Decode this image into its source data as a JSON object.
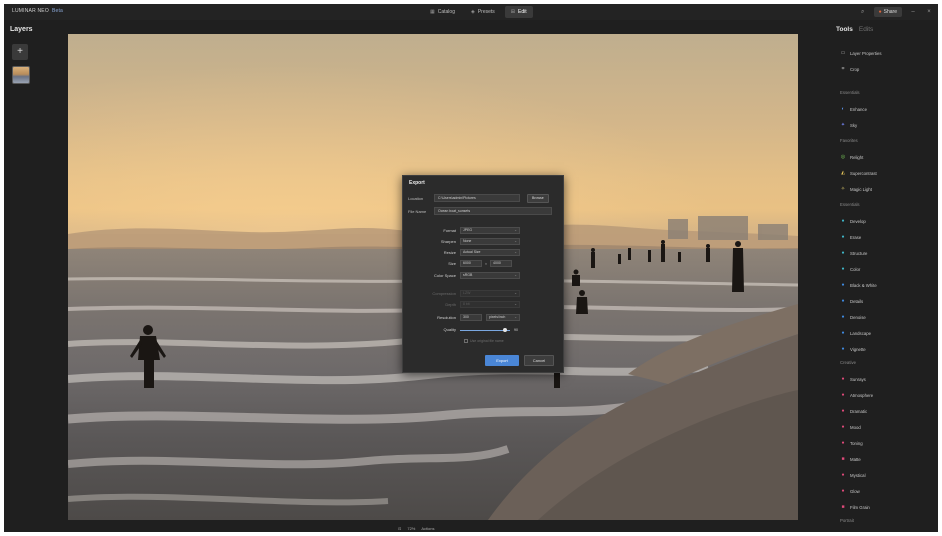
{
  "topbar": {
    "brand": "LUMINAR NEO",
    "edition": "Beta",
    "modes": [
      {
        "icon": "catalog-icon",
        "glyph": "▦",
        "label": "Catalog",
        "active": false
      },
      {
        "icon": "presets-icon",
        "glyph": "◈",
        "label": "Presets",
        "active": false
      },
      {
        "icon": "edit-icon",
        "glyph": "⊞",
        "label": "Edit",
        "active": true
      }
    ],
    "share_label": "Share"
  },
  "left_panel": {
    "title": "Layers",
    "add_glyph": "+"
  },
  "export_dialog": {
    "title": "Export",
    "location_label": "Location",
    "location_value": "C:\\Users\\admin\\Pictures",
    "browse_label": "Browse",
    "filename_label": "File Name",
    "filename_value": "Ocean boat_sunsets",
    "fields": [
      {
        "label": "Format",
        "value": "JPEG",
        "disabled": false
      },
      {
        "label": "Sharpen",
        "value": "None",
        "disabled": false
      },
      {
        "label": "Resize",
        "value": "Actual Size",
        "disabled": false
      },
      {
        "label": "Size",
        "value_w": "6000",
        "value_h": "4000",
        "type": "size",
        "disabled": false
      },
      {
        "label": "Color Space",
        "value": "sRGB",
        "disabled": false
      },
      {
        "label": "Compression",
        "value": "LZW",
        "disabled": true
      },
      {
        "label": "Depth",
        "value": "8 bit",
        "disabled": true
      },
      {
        "label": "Resolution",
        "value": "300",
        "unit": "pixels/inch",
        "type": "resolution",
        "disabled": false
      },
      {
        "label": "Quality",
        "value": "90",
        "level": 0.9,
        "type": "slider",
        "disabled": false
      }
    ],
    "checkbox_label": "Use original file name",
    "export_label": "Export",
    "cancel_label": "Cancel"
  },
  "zoombar": {
    "fit_glyph": "⊡",
    "zoom": "72%",
    "extra": "Actions"
  },
  "right_panel": {
    "tabs": [
      "Tools",
      "Edits"
    ],
    "top_items": [
      {
        "icon": "layer-properties-icon",
        "glyph": "▭",
        "label": "Layer Properties",
        "color": "#aaaaaa"
      },
      {
        "icon": "crop-icon",
        "glyph": "⌗",
        "label": "Crop",
        "color": "#aaaaaa"
      }
    ],
    "sections": [
      {
        "title": "Essentials",
        "items": []
      },
      {
        "title": "Favorites",
        "items": []
      },
      {
        "title": "Creative",
        "items": []
      }
    ],
    "items": [
      {
        "icon": "enhance-icon",
        "glyph": "◐",
        "label": "Enhance",
        "color": "#5a8ee0"
      },
      {
        "icon": "sky-icon",
        "glyph": "✦",
        "label": "Sky",
        "color": "#6f7fe8"
      },
      {
        "icon": "relight-icon",
        "glyph": "◎",
        "label": "Relight",
        "color": "#7ccf5a"
      },
      {
        "icon": "supercontrast-icon",
        "glyph": "◭",
        "label": "Supercontrast",
        "color": "#e3c35a"
      },
      {
        "icon": "magic-light-icon",
        "glyph": "✧",
        "label": "Magic Light",
        "color": "#e8d470"
      },
      {
        "icon": "develop-icon",
        "glyph": "●",
        "label": "Develop",
        "color": "#3fb6c8"
      },
      {
        "icon": "erase-icon",
        "glyph": "●",
        "label": "Erase",
        "color": "#3fb6c8"
      },
      {
        "icon": "structure-icon",
        "glyph": "●",
        "label": "Structure",
        "color": "#3fb6c8"
      },
      {
        "icon": "color-icon",
        "glyph": "●",
        "label": "Color",
        "color": "#3fb6c8"
      },
      {
        "icon": "black-white-icon",
        "glyph": "●",
        "label": "Black & White",
        "color": "#3f8ae0"
      },
      {
        "icon": "details-icon",
        "glyph": "●",
        "label": "Details",
        "color": "#3f8ae0"
      },
      {
        "icon": "denoise-icon",
        "glyph": "●",
        "label": "Denoise",
        "color": "#3f8ae0"
      },
      {
        "icon": "landscape-icon",
        "glyph": "●",
        "label": "Landscape",
        "color": "#3f8ae0"
      },
      {
        "icon": "vignette-icon",
        "glyph": "●",
        "label": "Vignette",
        "color": "#3f8ae0"
      },
      {
        "icon": "sunrays-icon",
        "glyph": "●",
        "label": "Sunrays",
        "color": "#e04a7a"
      },
      {
        "icon": "atmosphere-icon",
        "glyph": "●",
        "label": "Atmosphere",
        "color": "#e04a7a"
      },
      {
        "icon": "dramatic-icon",
        "glyph": "●",
        "label": "Dramatic",
        "color": "#e04a7a"
      },
      {
        "icon": "mood-icon",
        "glyph": "●",
        "label": "Mood",
        "color": "#e04a7a"
      },
      {
        "icon": "toning-icon",
        "glyph": "●",
        "label": "Toning",
        "color": "#e04a7a"
      },
      {
        "icon": "matte-icon",
        "glyph": "■",
        "label": "Matte",
        "color": "#e04a7a"
      },
      {
        "icon": "mystical-icon",
        "glyph": "●",
        "label": "Mystical",
        "color": "#e04a7a"
      },
      {
        "icon": "glow-icon",
        "glyph": "●",
        "label": "Glow",
        "color": "#e04a7a"
      },
      {
        "icon": "film-grain-icon",
        "glyph": "■",
        "label": "Film Grain",
        "color": "#e04a7a"
      }
    ],
    "section_titles": [
      "Essentials",
      "Favorites",
      "Essentials",
      "Creative",
      "Portrait"
    ]
  },
  "colors": {
    "accent": "#4a86d6",
    "bg": "#1f1f1f",
    "panel": "#2b2b2b"
  }
}
